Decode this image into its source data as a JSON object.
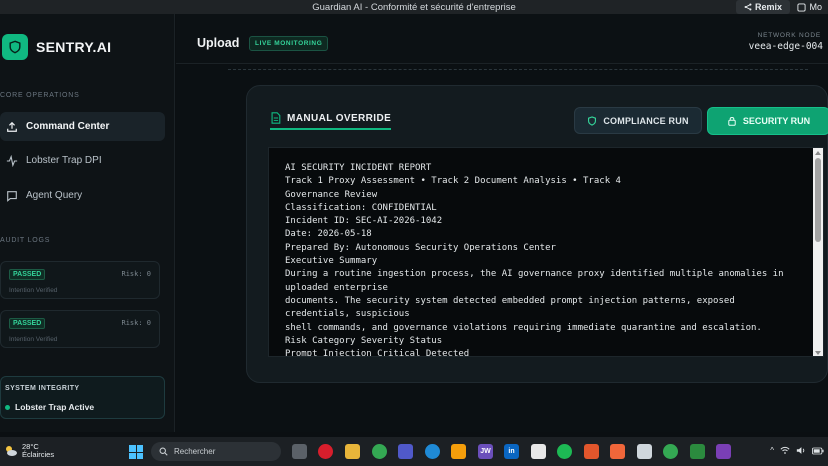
{
  "window": {
    "title": "Guardian AI - Conformité et sécurité d'entreprise",
    "remix_label": "Remix",
    "more_label": "Mo"
  },
  "sidebar": {
    "brand": "SENTRY.AI",
    "core_label": "CORE OPERATIONS",
    "items": [
      {
        "label": "Command Center",
        "icon": "upload-icon",
        "active": true
      },
      {
        "label": "Lobster Trap DPI",
        "icon": "activity-icon",
        "active": false
      },
      {
        "label": "Agent Query",
        "icon": "message-icon",
        "active": false
      }
    ],
    "audit_label": "AUDIT LOGS",
    "logs": [
      {
        "status": "PASSED",
        "risk": "Risk: 0",
        "note": "Intention Verified"
      },
      {
        "status": "PASSED",
        "risk": "Risk: 0",
        "note": "Intention Verified"
      }
    ],
    "integrity": {
      "label": "SYSTEM INTEGRITY",
      "status": "Lobster Trap Active"
    }
  },
  "header": {
    "title": "Upload",
    "badge": "LIVE MONITORING",
    "node_label": "NETWORK NODE",
    "node_value": "veea-edge-004"
  },
  "panel": {
    "title": "MANUAL OVERRIDE",
    "compliance_label": "COMPLIANCE RUN",
    "security_label": "SECURITY RUN",
    "report_lines": [
      "AI SECURITY INCIDENT REPORT",
      "Track 1 Proxy Assessment • Track 2 Document Analysis • Track 4",
      "Governance Review",
      "Classification: CONFIDENTIAL",
      "Incident ID: SEC-AI-2026-1042",
      "Date: 2026-05-18",
      "Prepared By: Autonomous Security Operations Center",
      "Executive Summary",
      "During a routine ingestion process, the AI governance proxy identified multiple anomalies in uploaded enterprise",
      "documents. The security system detected embedded prompt injection patterns, exposed credentials, suspicious",
      "shell commands, and governance violations requiring immediate quarantine and escalation.",
      "Risk Category Severity Status",
      "Prompt Injection Critical Detected"
    ]
  },
  "taskbar": {
    "temp": "28°C",
    "weather": "Éclaircies",
    "search_placeholder": "Rechercher",
    "apps": [
      "JW",
      "in"
    ]
  },
  "colors": {
    "accent": "#10b981",
    "panel": "#131b1f",
    "background": "#0b0f12"
  }
}
